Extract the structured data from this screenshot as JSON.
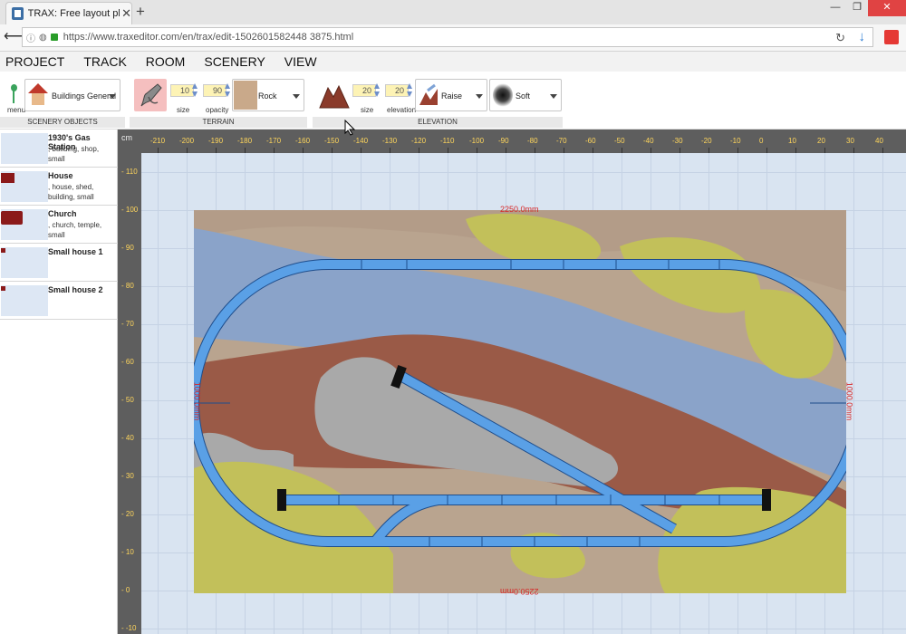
{
  "browser": {
    "tab_title": "TRAX: Free layout planning",
    "url": "https://www.traxeditor.com/en/trax/edit-1502601582448 3875.html"
  },
  "menu": [
    "PROJECT",
    "TRACK",
    "ROOM",
    "SCENERY",
    "VIEW"
  ],
  "toolbar": {
    "menu_label": "menu",
    "scenery_dropdown": "Buildings General",
    "scenery_group": "SCENERY OBJECTS",
    "terrain_group": "TERRAIN",
    "terrain_size": "10",
    "terrain_size_label": "size",
    "terrain_opacity": "90",
    "terrain_opacity_label": "opacity",
    "terrain_dropdown": "Rock",
    "elevation_group": "ELEVATION",
    "elev_size": "20",
    "elev_size_label": "size",
    "elev_value": "20",
    "elev_value_label": "elevation",
    "elev_mode": "Raise",
    "elev_brush": "Soft"
  },
  "objects": [
    {
      "name": "1930's Gas Station",
      "tags": ", building, shop, small"
    },
    {
      "name": "House",
      "tags": ", house, shed, building, small"
    },
    {
      "name": "Church",
      "tags": ", church, temple, small"
    },
    {
      "name": "Small house 1",
      "tags": ""
    },
    {
      "name": "Small house 2",
      "tags": ""
    }
  ],
  "ruler": {
    "unit": "cm",
    "top_ticks": [
      "-210",
      "-200",
      "-190",
      "-180",
      "-170",
      "-160",
      "-150",
      "-140",
      "-130",
      "-120",
      "-110",
      "-100",
      "-90",
      "-80",
      "-70",
      "-60",
      "-50",
      "-40",
      "-30",
      "-20",
      "-10",
      "0",
      "10",
      "20",
      "30",
      "40"
    ],
    "left_ticks": [
      "110",
      "100",
      "90",
      "80",
      "70",
      "60",
      "50",
      "40",
      "30",
      "20",
      "10",
      "0",
      "-10"
    ]
  },
  "board": {
    "width_label": "2250.0mm",
    "height_label": "1000.0mm"
  },
  "colors": {
    "track": "#5aa0e6",
    "track_edge": "#1f4e8c",
    "water": "#8aa3c9",
    "soil": "#9a5a47",
    "rock": "#a9a9a9",
    "grass": "#c2c05a",
    "sand": "#b9a48f"
  }
}
